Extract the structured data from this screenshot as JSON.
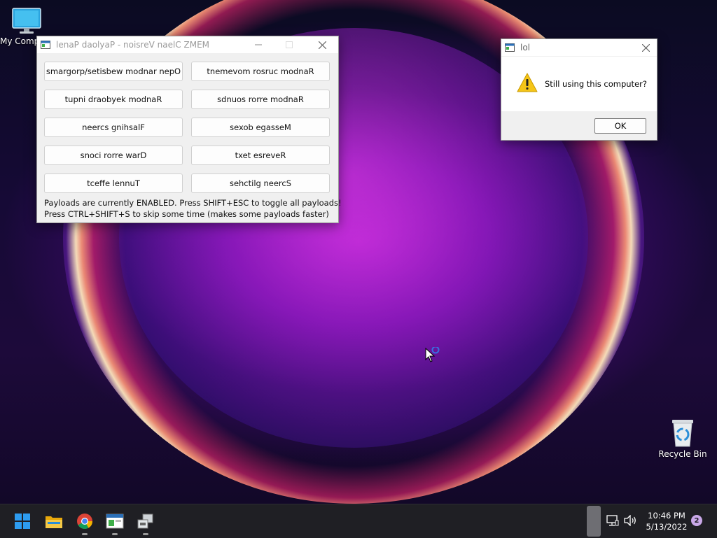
{
  "desktop": {
    "icons": [
      {
        "label": "My Computer"
      },
      {
        "label": "Recycle Bin"
      }
    ]
  },
  "memz_window": {
    "title": "lenaP daolyaP - noisreV naelC ZMEM",
    "buttons": [
      "smargorp/setisbew modnar nepO",
      "tnemevom rosruc modnaR",
      "tupni draobyek modnaR",
      "sdnuos rorre modnaR",
      "neercs gnihsalF",
      "sexob egasseM",
      "snoci rorre warD",
      "txet esreveR",
      "tceffe lennuT",
      "sehctilg neercS"
    ],
    "status_line1": "Payloads are currently ENABLED. Press SHIFT+ESC to toggle all payloads!",
    "status_line2": "Press CTRL+SHIFT+S to skip some time (makes some payloads faster)"
  },
  "message_box": {
    "title": "lol",
    "message": "Still using this computer?",
    "ok_label": "OK"
  },
  "taskbar": {
    "time": "10:46 PM",
    "date": "5/13/2022",
    "notification_count": "2"
  },
  "colors": {
    "taskbar_bg": "#1f1f24",
    "warning_yellow": "#f5c518",
    "start_blue": "#2d9cf0"
  }
}
